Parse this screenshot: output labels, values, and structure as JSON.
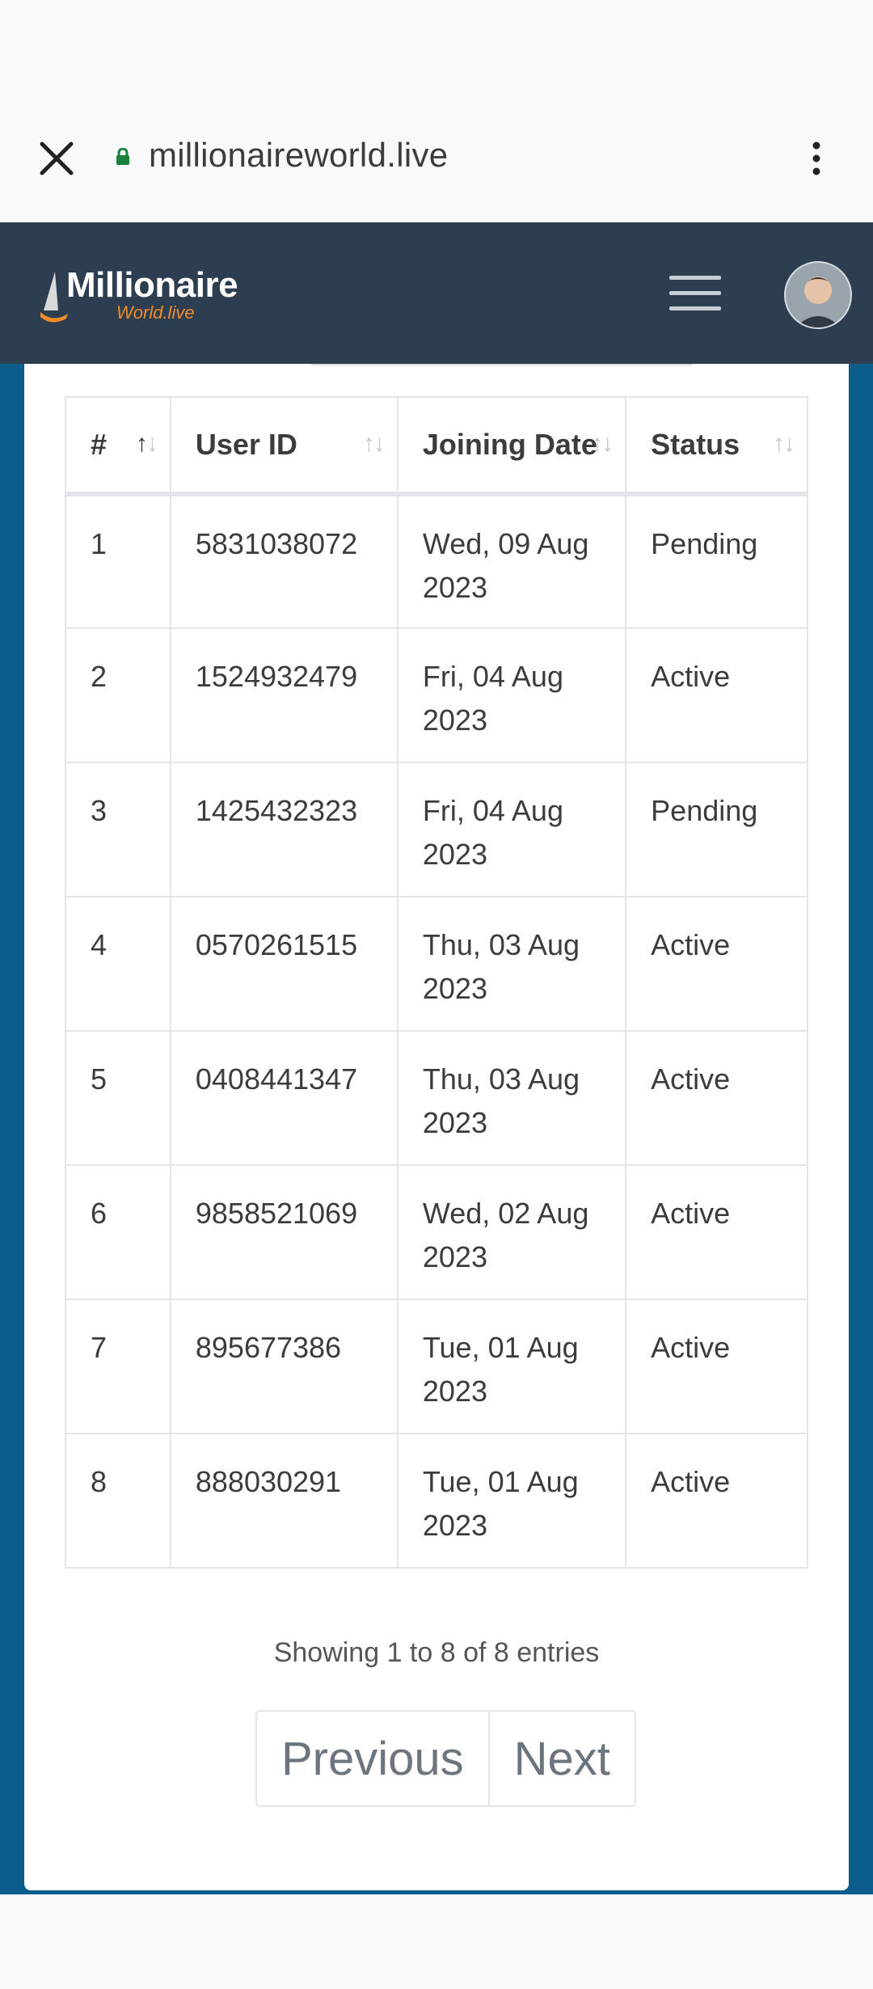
{
  "browser": {
    "url": "millionaireworld.live"
  },
  "header": {
    "logo_title": "Millionaire",
    "logo_sub": "World.live"
  },
  "table": {
    "columns": [
      "#",
      "User ID",
      "Joining Date",
      "Status"
    ],
    "rows": [
      {
        "num": "1",
        "uid": "5831038072",
        "date_line1": "Wed, 09 Aug",
        "date_line2": "2023",
        "status": "Pending"
      },
      {
        "num": "2",
        "uid": "1524932479",
        "date_line1": "Fri, 04 Aug",
        "date_line2": "2023",
        "status": "Active"
      },
      {
        "num": "3",
        "uid": "1425432323",
        "date_line1": "Fri, 04 Aug",
        "date_line2": "2023",
        "status": "Pending"
      },
      {
        "num": "4",
        "uid": "0570261515",
        "date_line1": "Thu, 03 Aug",
        "date_line2": "2023",
        "status": "Active"
      },
      {
        "num": "5",
        "uid": "0408441347",
        "date_line1": "Thu, 03 Aug",
        "date_line2": "2023",
        "status": "Active"
      },
      {
        "num": "6",
        "uid": "9858521069",
        "date_line1": "Wed, 02 Aug",
        "date_line2": "2023",
        "status": "Active"
      },
      {
        "num": "7",
        "uid": "895677386",
        "date_line1": "Tue, 01 Aug",
        "date_line2": "2023",
        "status": "Active"
      },
      {
        "num": "8",
        "uid": "888030291",
        "date_line1": "Tue, 01 Aug",
        "date_line2": "2023",
        "status": "Active"
      }
    ]
  },
  "footer": {
    "info": "Showing 1 to 8 of 8 entries",
    "previous": "Previous",
    "next": "Next"
  }
}
